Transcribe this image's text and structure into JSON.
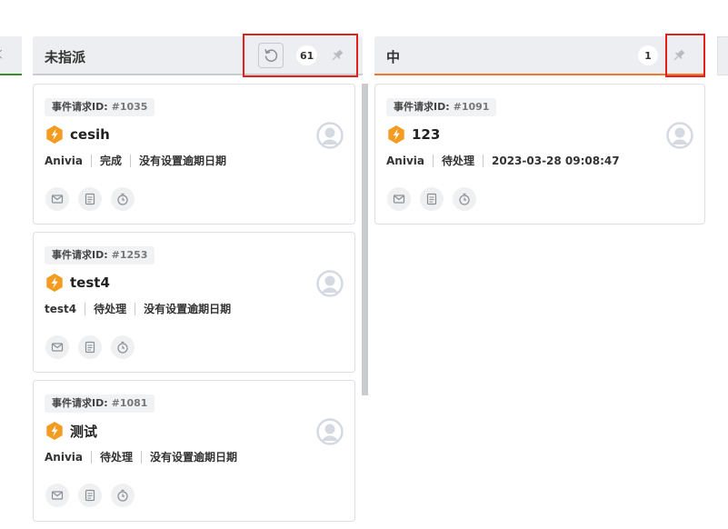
{
  "columns": [
    {
      "title": "未指派",
      "count": "61"
    },
    {
      "title": "中",
      "count": "1"
    }
  ],
  "cards": [
    {
      "id_label": "事件请求ID:",
      "id_value": "#1035",
      "title": "cesih",
      "meta": [
        "Anivia",
        "完成",
        "没有设置逾期日期"
      ]
    },
    {
      "id_label": "事件请求ID:",
      "id_value": "#1253",
      "title": "test4",
      "meta": [
        "test4",
        "待处理",
        "没有设置逾期日期"
      ]
    },
    {
      "id_label": "事件请求ID:",
      "id_value": "#1081",
      "title": "测试",
      "meta": [
        "Anivia",
        "待处理",
        "没有设置逾期日期"
      ]
    },
    {
      "id_label": "事件请求ID:",
      "id_value": "#1091",
      "title": "123",
      "meta": [
        "Anivia",
        "待处理",
        "2023-03-28 09:08:47"
      ]
    }
  ],
  "colors": {
    "accent_orange": "#f0782d",
    "accent_green": "#3a8f2a",
    "type_icon": "#f39c1f",
    "highlight": "#e3211c"
  },
  "icons": {
    "refresh": "refresh-icon",
    "pin": "pin-icon",
    "type": "incident-type-icon",
    "avatar": "avatar-icon",
    "mail": "mail-icon",
    "note": "note-icon",
    "timer": "timer-icon"
  }
}
